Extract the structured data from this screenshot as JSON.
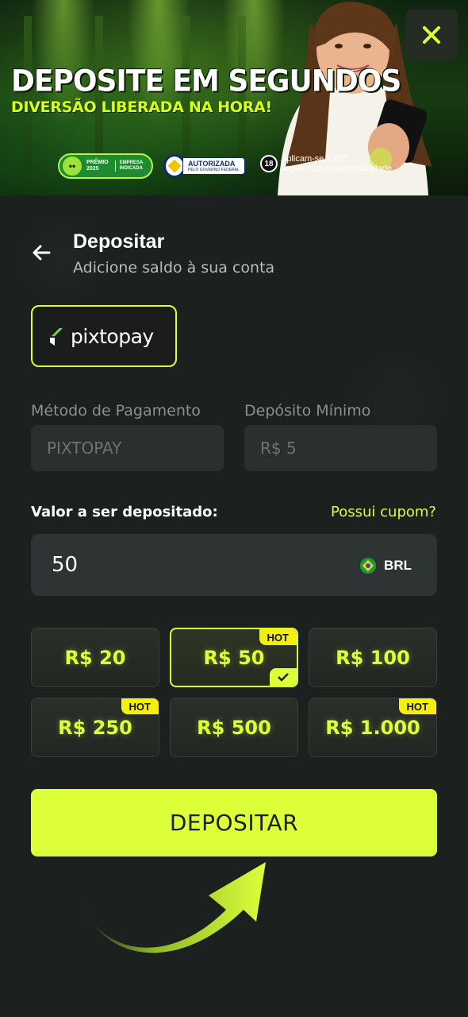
{
  "banner": {
    "headline": "DEPOSITE EM SEGUNDOS",
    "subline": "DIVERSÃO LIBERADA NA HORA!",
    "badge_premio_line1": "PRÊMIO",
    "badge_premio_line2": "2025",
    "badge_premio_line3": "EMPRESA",
    "badge_premio_line4": "INDICADA",
    "badge_autorizada": "AUTORIZADA",
    "badge_autorizada_sub": "PELO GOVERNO FEDERAL",
    "age_badge": "18",
    "age_text_line1": "Aplicam-se T&C*.",
    "age_text_line2": "Jogue com responsabilidade",
    "close_icon": "close-icon"
  },
  "header": {
    "title": "Depositar",
    "subtitle": "Adicione saldo à sua conta",
    "back_icon": "arrow-left-icon"
  },
  "payment_provider": {
    "name": "pixtopay",
    "selected": true
  },
  "fields": {
    "method_label": "Método de Pagamento",
    "method_value": "PIXTOPAY",
    "min_label": "Depósito Mínimo",
    "min_value": "R$ 5"
  },
  "amount": {
    "label": "Valor a ser depositado:",
    "coupon_link": "Possui cupom?",
    "value": "50",
    "currency": "BRL"
  },
  "presets": [
    {
      "label": "R$ 20",
      "hot": false,
      "selected": false
    },
    {
      "label": "R$ 50",
      "hot": true,
      "selected": true
    },
    {
      "label": "R$ 100",
      "hot": false,
      "selected": false
    },
    {
      "label": "R$ 250",
      "hot": true,
      "selected": false
    },
    {
      "label": "R$ 500",
      "hot": false,
      "selected": false
    },
    {
      "label": "R$ 1.000",
      "hot": true,
      "selected": false
    }
  ],
  "hot_label": "HOT",
  "submit": {
    "label": "DEPOSITAR"
  },
  "colors": {
    "accent": "#dcff3a",
    "background": "#1c201f",
    "field": "#2b302f",
    "hot_badge": "#f4ef0c"
  }
}
